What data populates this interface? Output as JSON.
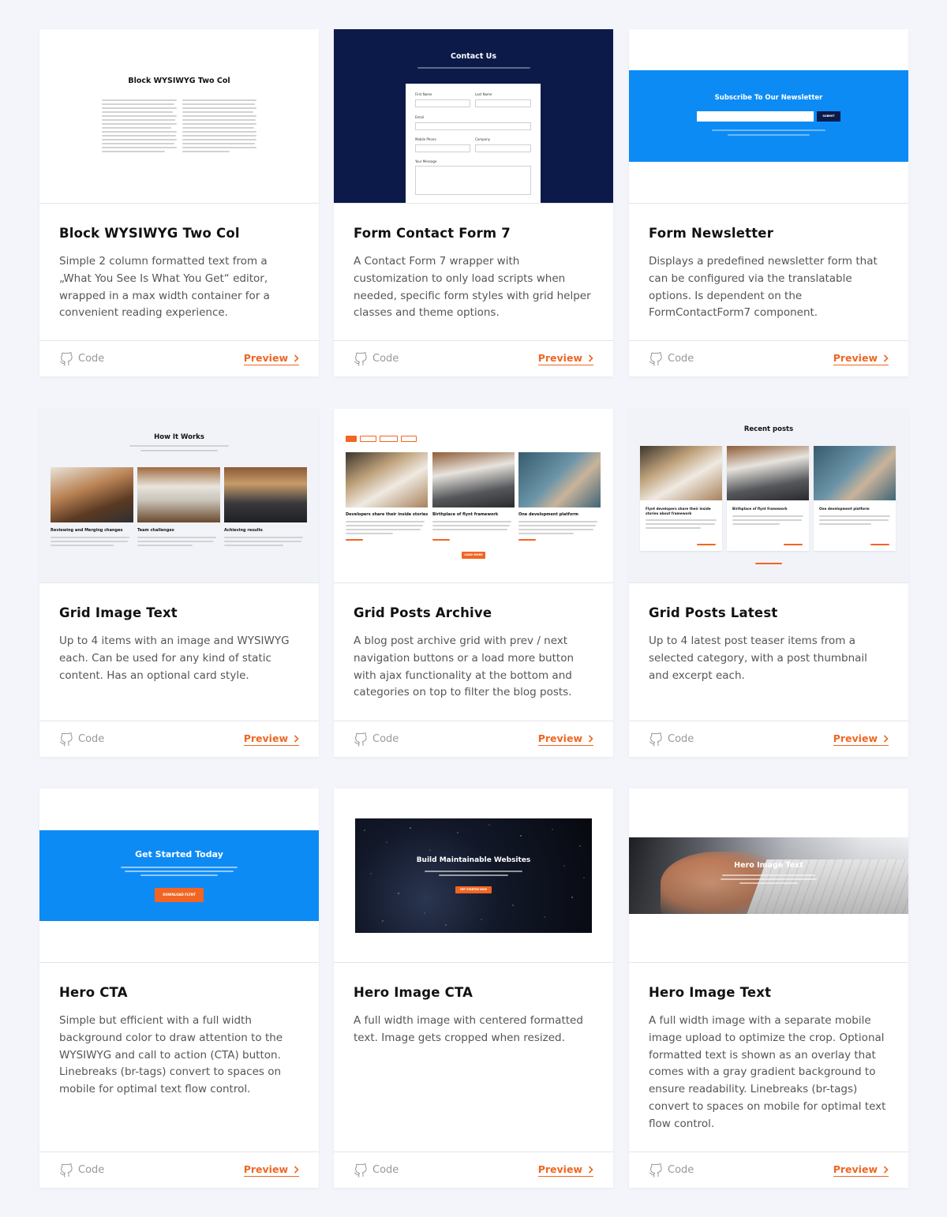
{
  "colors": {
    "accent": "#ee6723",
    "blue": "#0d8bf5",
    "navy": "#0c1a4a",
    "background": "#f3f5fb"
  },
  "icons": {
    "code": "github-icon",
    "preview": "chevron-right-icon"
  },
  "common": {
    "code_label": "Code",
    "preview_label": "Preview"
  },
  "cards": [
    {
      "title": "Block WYSIWYG Two Col",
      "description": "Simple 2 column formatted text from a „What You See Is What You Get“ editor, wrapped in a max width container for a convenient reading experience.",
      "thumb": {
        "heading": "Block WYSIWYG Two Col"
      }
    },
    {
      "title": "Form Contact Form 7",
      "description": "A Contact Form 7 wrapper with customization to only load scripts when needed, specific form styles with grid helper classes and theme options.",
      "thumb": {
        "heading": "Contact Us",
        "fields": {
          "first_name": "First Name",
          "last_name": "Last Name",
          "email": "Email",
          "mobile": "Mobile Phone",
          "company": "Company",
          "message": "Your Message"
        }
      }
    },
    {
      "title": "Form Newsletter",
      "description": "Displays a predefined newsletter form that can be configured via the translatable options. Is dependent on the FormContactForm7 component.",
      "thumb": {
        "heading": "Subscribe To Our Newsletter",
        "button": "SUBMIT"
      }
    },
    {
      "title": "Grid Image Text",
      "description": "Up to 4 items with an image and WYSIWYG each. Can be used for any kind of static content. Has an optional card style.",
      "thumb": {
        "heading": "How It Works",
        "items": [
          "Reviewing and Merging changes",
          "Team challenges",
          "Achieving results"
        ]
      }
    },
    {
      "title": "Grid Posts Archive",
      "description": "A blog post archive grid with prev / next navigation buttons or a load more button with ajax functionality at the bottom and categories on top to filter the blog posts.",
      "thumb": {
        "items": [
          "Developers share their inside stories",
          "Birthplace of flynt framework",
          "One development platform"
        ],
        "button": "LOAD MORE"
      }
    },
    {
      "title": "Grid Posts Latest",
      "description": "Up to 4 latest post teaser items from a selected category, with a post thumbnail and excerpt each.",
      "thumb": {
        "heading": "Recent posts",
        "items": [
          "Flynt developers share their inside stories about framework",
          "Birthplace of flynt framework",
          "One development platform"
        ]
      }
    },
    {
      "title": "Hero CTA",
      "description": "Simple but efficient with a full width background color to draw attention to the WYSIWYG and call to action (CTA) button. Linebreaks (br-tags) convert to spaces on mobile for optimal text flow control.",
      "thumb": {
        "heading": "Get Started Today",
        "button": "DOWNLOAD FLYNT"
      }
    },
    {
      "title": "Hero Image CTA",
      "description": "A full width image with centered formatted text. Image gets cropped when resized.",
      "thumb": {
        "heading": "Build Maintainable Websites",
        "button": "GET STARTED NOW"
      }
    },
    {
      "title": "Hero Image Text",
      "description": "A full width image with a separate mobile image upload to optimize the crop. Optional formatted text is shown as an overlay that comes with a gray gradient background to ensure readability. Linebreaks (br-tags) convert to spaces on mobile for optimal text flow control.",
      "thumb": {
        "heading": "Hero Image Text"
      }
    }
  ]
}
